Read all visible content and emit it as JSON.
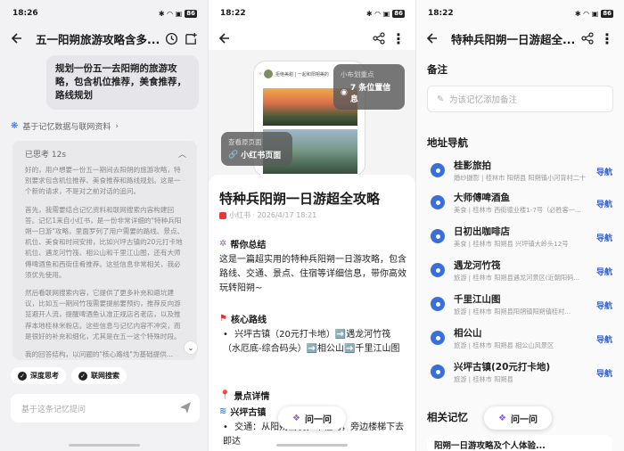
{
  "panel1": {
    "status": {
      "time": "18:26",
      "battery": "86"
    },
    "nav": {
      "title": "五一阳朔旅游攻略含多..."
    },
    "query": "规划一份五一去阳朔的旅游攻略，包含机位推荐，美食推荐，路线规划",
    "memory_note": "基于记忆数据与联网资料",
    "think": {
      "header": "已思考 12s",
      "paragraphs": [
        "好的，用户想要一份五一期间去阳朔的旅游攻略，特别要求包含机位推荐、美食推荐和路线规划。这是一个新的请求，不是对之前对话的追问。",
        "首先，我需要结合记忆资料和联网搜索内容构建回答。记忆1来自小红书，是一份非常详细的\"特种兵阳朔一日游\"攻略，里面罗列了用户需要的路线、景点、机位、美食和时间安排，比如兴坪古镇的20元打卡地机位、遇龙河竹筏、相公山和千里江山图，还有大师傅啤酒鱼和西街佳肴推荐。这些信息非常相关，我必须优先使用。",
        "然后看联网搜索内容，它提供了更多补充和避坑建议，比如五一期间竹筏需要提前要预约，推荐反向游览避开人流，提醒啤酒鱼认准正规店名老店，以及推荐本地桂林米粉店。这些信息与记忆内容不冲突，而是很好的补充和细化，尤其是在五一这个特殊时段。",
        "我的回答结构，以问题的\"核心路线\"为基础提供..."
      ]
    },
    "chips": [
      "深度思考",
      "联网搜索"
    ],
    "input_placeholder": "基于这条记忆提问"
  },
  "panel2": {
    "status": {
      "time": "18:22",
      "battery": "86"
    },
    "preview_author": "拒绝美甜 | 一起和阳朔美的",
    "overlay_top": {
      "sub": "小布划重点",
      "main": "7 条位置信息"
    },
    "overlay_left": {
      "sub": "查看原页面",
      "main": "小红书页面"
    },
    "article": {
      "title": "特种兵阳朔一日游超全攻略",
      "meta": "小红书 · 2026/4/17 18:21",
      "summary_title": "帮你总结",
      "summary": "这是一篇超实用的特种兵阳朔一日游攻略，包含路线、交通、景点、住宿等详细信息，带你高效玩转阳朔~",
      "route_title": "核心路线",
      "route": "兴坪古镇（20元打卡地）➡️遇龙河竹筏（水厄底-综合码头）➡️相公山➡️千里江山图",
      "detail_title": "景点详情",
      "detail_sub": "兴坪古镇",
      "traffic": "交通：从阳朔出发，车程约，旁边楼梯下去即达"
    },
    "ask_label": "问一问"
  },
  "panel3": {
    "status": {
      "time": "18:22",
      "battery": "86"
    },
    "nav": {
      "title": "特种兵阳朔一日游超全..."
    },
    "note_label": "备注",
    "note_placeholder": "为该记忆添加备注",
    "addr_label": "地址导航",
    "nav_label": "导航",
    "addresses": [
      {
        "name": "桂影旅拍",
        "desc": "婚纱摄影 | 桂林市 阳朔县 阳朔镇小河背村二十元..."
      },
      {
        "name": "大师傅啤酒鱼",
        "desc": "美食 | 桂林市 西街德业楼1-7号（必胜客一..."
      },
      {
        "name": "日初出咖啡店",
        "desc": "美食 | 桂林市 阳朔县 兴坪镇大岭头12号"
      },
      {
        "name": "遇龙河竹筏",
        "desc": "旅游 | 桂林市 阳朔县遇龙河景区(近朝阳码..."
      },
      {
        "name": "千里江山图",
        "desc": "旅游 | 桂林市 阳朔县阳朔镇阳朔镇桂村..."
      },
      {
        "name": "相公山",
        "desc": "旅游 | 桂林市 阳朔县 相公山风景区"
      },
      {
        "name": "兴坪古镇(20元打卡地)",
        "desc": "旅游 | 桂林市 阳朔县"
      }
    ],
    "related_label": "相关记忆",
    "related_item": "阳朔一日游攻略及个人体验...",
    "ask_label": "问一问"
  }
}
